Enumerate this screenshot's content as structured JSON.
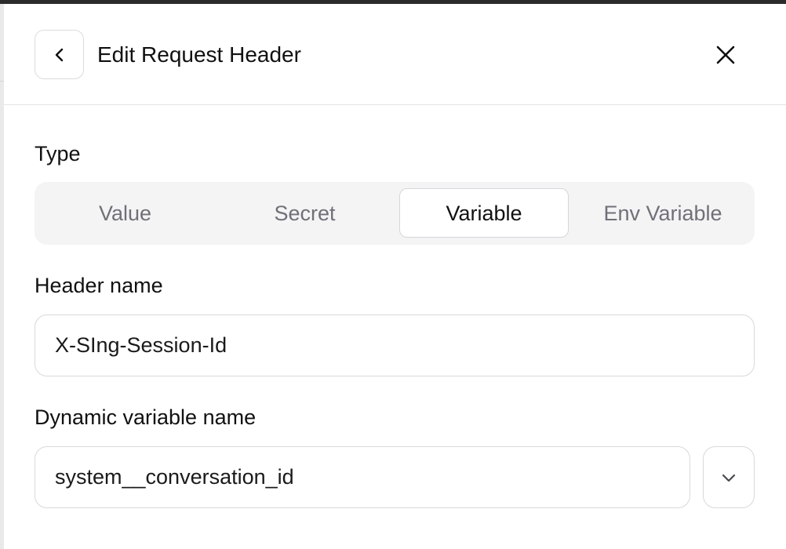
{
  "header": {
    "title": "Edit Request Header",
    "back_icon": "chevron-left-icon",
    "close_icon": "close-icon"
  },
  "type_section": {
    "label": "Type",
    "options": [
      {
        "label": "Value"
      },
      {
        "label": "Secret"
      },
      {
        "label": "Variable"
      },
      {
        "label": "Env Variable"
      }
    ],
    "selected": "Variable"
  },
  "header_name": {
    "label": "Header name",
    "value": "X-SIng-Session-Id"
  },
  "dynamic_variable": {
    "label": "Dynamic variable name",
    "value": "system__conversation_id",
    "dropdown_icon": "chevron-down-icon"
  },
  "colors": {
    "text_primary": "#111111",
    "text_muted": "#707078",
    "border": "#d9d9dd",
    "segment_bg": "#f4f4f5"
  }
}
